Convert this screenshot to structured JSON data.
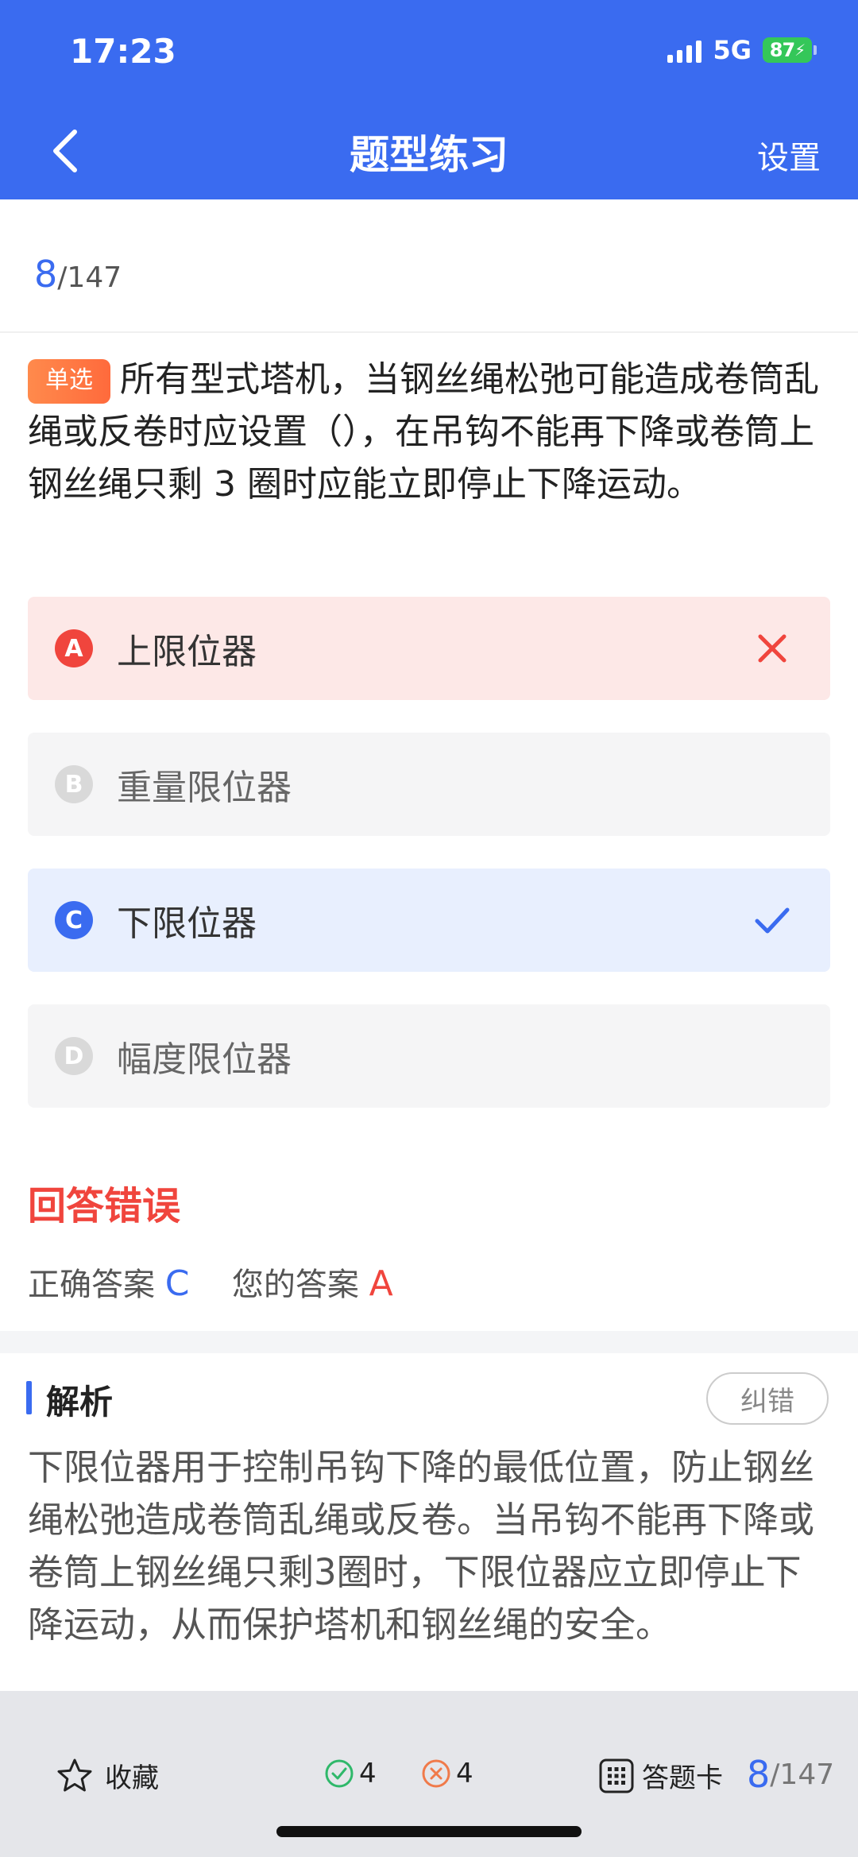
{
  "status": {
    "time": "17:23",
    "network": "5G",
    "battery": "87"
  },
  "nav": {
    "title": "题型练习",
    "settings_label": "设置"
  },
  "progress": {
    "current": "8",
    "total": "/147"
  },
  "question": {
    "type_tag": "单选",
    "text": "所有型式塔机，当钢丝绳松弛可能造成卷筒乱绳或反卷时应设置（），在吊钩不能再下降或卷筒上钢丝绳只剩 3 圈时应能立即停止下降运动。"
  },
  "options": [
    {
      "letter": "A",
      "text": "上限位器",
      "state": "wrong"
    },
    {
      "letter": "B",
      "text": "重量限位器",
      "state": "normal"
    },
    {
      "letter": "C",
      "text": "下限位器",
      "state": "correct"
    },
    {
      "letter": "D",
      "text": "幅度限位器",
      "state": "normal"
    }
  ],
  "result": {
    "title": "回答错误",
    "correct_label": "正确答案",
    "correct_value": "C",
    "your_label": "您的答案",
    "your_value": "A"
  },
  "analysis": {
    "title": "解析",
    "report_label": "纠错",
    "text": "下限位器用于控制吊钩下降的最低位置，防止钢丝绳松弛造成卷筒乱绳或反卷。当吊钩不能再下降或卷筒上钢丝绳只剩3圈时，下限位器应立即停止下降运动，从而保护塔机和钢丝绳的安全。"
  },
  "bottom_bar": {
    "favorite_label": "收藏",
    "correct_count": "4",
    "wrong_count": "4",
    "answer_card_label": "答题卡",
    "progress_current": "8",
    "progress_total": "/147"
  },
  "colors": {
    "header": "#3a6bf0",
    "accent_blue": "#3a6bf0",
    "error_red": "#f0453d",
    "wrong_bg": "#fde8e7",
    "correct_bg": "#e8effe",
    "normal_bg": "#f5f5f6",
    "tag_orange": "#ff7a45"
  }
}
